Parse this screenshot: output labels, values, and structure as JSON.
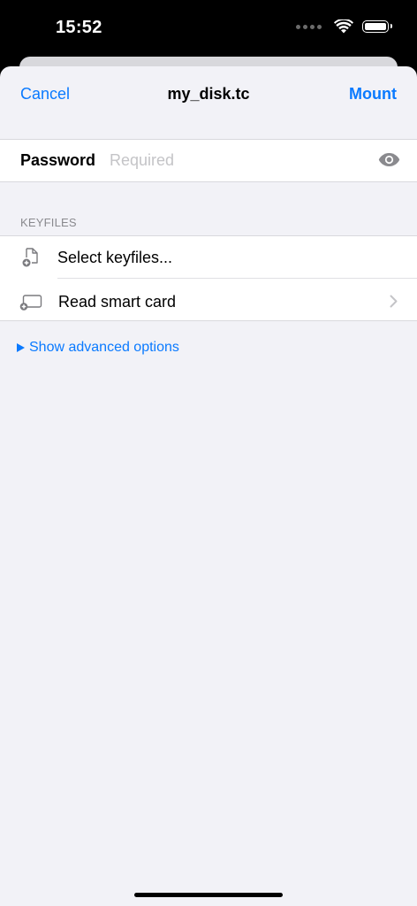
{
  "status_bar": {
    "time": "15:52",
    "icons": [
      "signal-dots-icon",
      "wifi-icon",
      "battery-icon"
    ]
  },
  "nav": {
    "cancel_label": "Cancel",
    "title": "my_disk.tc",
    "mount_label": "Mount"
  },
  "password": {
    "label": "Password",
    "value": "",
    "placeholder": "Required",
    "reveal_icon": "eye-icon"
  },
  "keyfiles": {
    "header": "KEYFILES",
    "items": [
      {
        "label": "Select keyfiles...",
        "icon": "add-file-icon",
        "has_chevron": false
      },
      {
        "label": "Read smart card",
        "icon": "add-smart-card-icon",
        "has_chevron": true
      }
    ]
  },
  "advanced": {
    "label": "Show advanced options",
    "icon": "disclosure-triangle-icon"
  },
  "colors": {
    "accent": "#0a7aff",
    "background": "#f2f2f7",
    "status_bar": "#000000"
  }
}
